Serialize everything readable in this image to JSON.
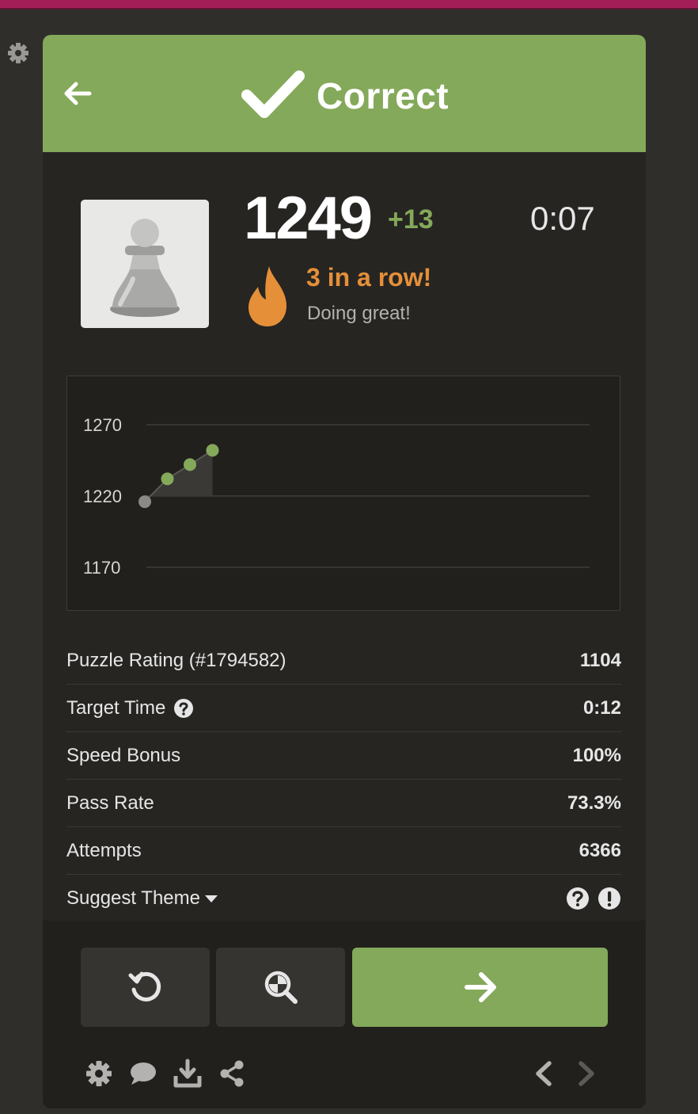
{
  "header": {
    "title": "Correct",
    "back_icon": "arrow-left-icon",
    "status_icon": "checkmark-icon",
    "color": "#84a95a"
  },
  "player": {
    "avatar_icon": "pawn-icon",
    "rating": "1249",
    "rating_change": "+13",
    "timer": "0:07",
    "streak_icon": "flame-icon",
    "streak_text": "3 in a row!",
    "streak_subtext": "Doing great!"
  },
  "chart_data": {
    "type": "line",
    "title": "",
    "xlabel": "",
    "ylabel": "",
    "yticks": [
      1270,
      1220,
      1170
    ],
    "ylim": [
      1170,
      1270
    ],
    "x": [
      1,
      2,
      3,
      4
    ],
    "values": [
      1216,
      1232,
      1242,
      1252
    ],
    "point_colors": [
      "#8b8a88",
      "#84a95a",
      "#84a95a",
      "#84a95a"
    ],
    "grid": true
  },
  "stats": [
    {
      "label": "Puzzle Rating (#1794582)",
      "value": "1104"
    },
    {
      "label": "Target Time",
      "value": "0:12",
      "icon": "question-circle-icon"
    },
    {
      "label": "Speed Bonus",
      "value": "100%"
    },
    {
      "label": "Pass Rate",
      "value": "73.3%"
    },
    {
      "label": "Attempts",
      "value": "6366"
    },
    {
      "label": "Suggest Theme",
      "value": "",
      "icon": "caret-down-icon"
    }
  ],
  "theme_icons": [
    "question-circle-icon",
    "exclamation-circle-icon"
  ],
  "buttons": {
    "retry_icon": "retry-icon",
    "analyze_icon": "analysis-magnifier-icon",
    "next_icon": "arrow-right-icon"
  },
  "tools": [
    "gear-icon",
    "chat-bubble-icon",
    "download-icon",
    "share-icon"
  ],
  "nav": {
    "prev_icon": "chevron-left-icon",
    "next_icon": "chevron-right-icon"
  }
}
